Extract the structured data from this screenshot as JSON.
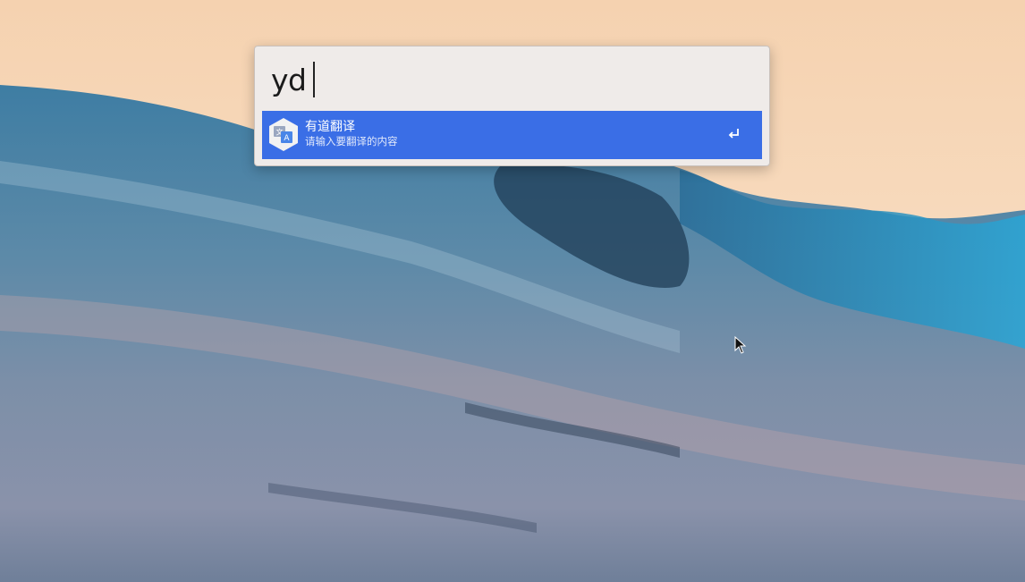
{
  "launcher": {
    "query": "yd",
    "results": [
      {
        "title": "有道翻译",
        "subtitle": "请输入要翻译的内容",
        "icon": "translate-icon",
        "action_icon": "enter-icon"
      }
    ]
  },
  "colors": {
    "selection": "#3a6ee6",
    "panel": "#efebe9",
    "sky": "#f8d8b8",
    "wave": "#3f7fa6"
  }
}
